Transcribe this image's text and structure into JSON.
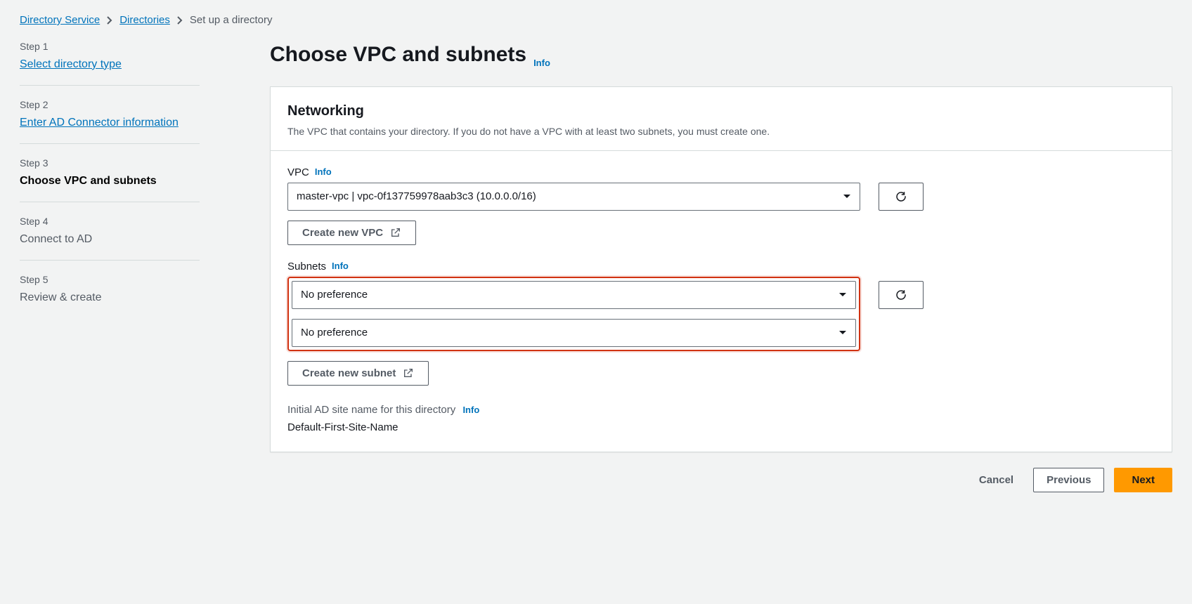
{
  "breadcrumb": {
    "root": "Directory Service",
    "mid": "Directories",
    "current": "Set up a directory"
  },
  "steps": [
    {
      "num": "Step 1",
      "label": "Select directory type",
      "state": "link"
    },
    {
      "num": "Step 2",
      "label": "Enter AD Connector information",
      "state": "link"
    },
    {
      "num": "Step 3",
      "label": "Choose VPC and subnets",
      "state": "current"
    },
    {
      "num": "Step 4",
      "label": "Connect to AD",
      "state": "future"
    },
    {
      "num": "Step 5",
      "label": "Review & create",
      "state": "future"
    }
  ],
  "page": {
    "title": "Choose VPC and subnets",
    "info": "Info"
  },
  "networking": {
    "title": "Networking",
    "desc": "The VPC that contains your directory. If you do not have a VPC with at least two subnets, you must create one.",
    "vpc_label": "VPC",
    "vpc_info": "Info",
    "vpc_value": "master-vpc | vpc-0f137759978aab3c3 (10.0.0.0/16)",
    "create_vpc": "Create new VPC",
    "subnets_label": "Subnets",
    "subnets_info": "Info",
    "subnet1_value": "No preference",
    "subnet2_value": "No preference",
    "create_subnet": "Create new subnet",
    "site_label": "Initial AD site name for this directory",
    "site_info": "Info",
    "site_value": "Default-First-Site-Name"
  },
  "footer": {
    "cancel": "Cancel",
    "previous": "Previous",
    "next": "Next"
  }
}
